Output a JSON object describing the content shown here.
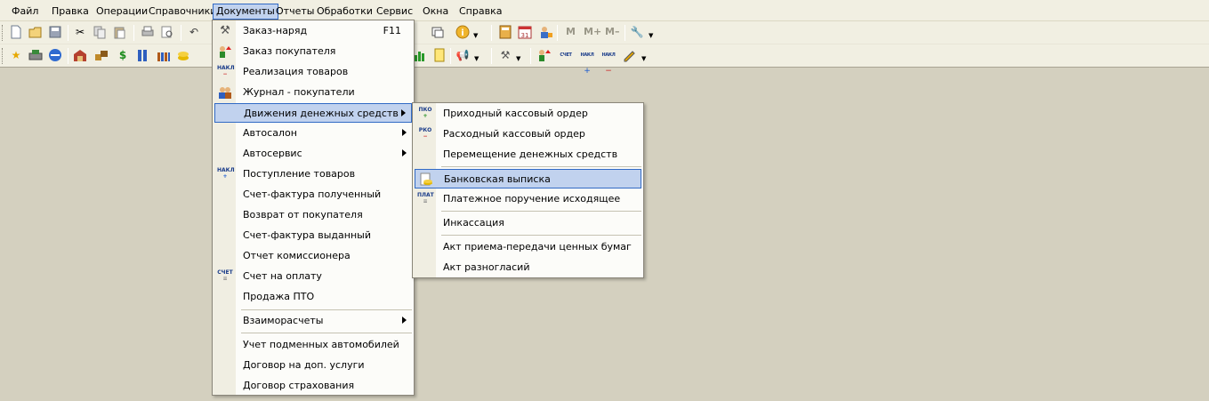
{
  "menubar": {
    "items": [
      {
        "label": "Файл",
        "key": "file"
      },
      {
        "label": "Правка",
        "key": "edit"
      },
      {
        "label": "Операции",
        "key": "operations"
      },
      {
        "label": "Справочники",
        "key": "references"
      },
      {
        "label": "Документы",
        "key": "documents"
      },
      {
        "label": "Отчеты",
        "key": "reports"
      },
      {
        "label": "Обработки",
        "key": "processing"
      },
      {
        "label": "Сервис",
        "key": "service"
      },
      {
        "label": "Окна",
        "key": "windows"
      },
      {
        "label": "Справка",
        "key": "help"
      }
    ]
  },
  "toolbar1": {
    "icons": [
      "new-icon",
      "open-icon",
      "save-icon",
      "cut-icon",
      "copy-icon",
      "paste-icon",
      "print-icon",
      "preview-icon",
      "undo-icon",
      "window-icon",
      "info-icon",
      "calculator-icon",
      "calendar-icon",
      "users-icon",
      "wrench-icon"
    ],
    "memory_buttons": [
      "M",
      "M+",
      "M–"
    ]
  },
  "toolbar2": {
    "icons": [
      "star-icon",
      "printer-icon",
      "exchange-icon",
      "warehouse-icon",
      "goods-icon",
      "dollar-icon",
      "people-icon",
      "group-icon",
      "coins-icon",
      "chart-icon",
      "horn-icon",
      "hammer-icon",
      "transfer-icon",
      "invoice-icon",
      "waybill-plus-icon",
      "waybill-minus-icon",
      "edit-doc-icon"
    ],
    "badges": {
      "invoice": "СЧЕТ",
      "waybill": "НАКЛ"
    }
  },
  "documents_menu": {
    "items": [
      {
        "label": "Заказ-наряд",
        "shortcut": "F11",
        "icon": "hammer-icon",
        "submenu": false
      },
      {
        "label": "Заказ покупателя",
        "icon": "order-icon",
        "submenu": false
      },
      {
        "label": "Реализация товаров",
        "icon": "waybill-minus-icon",
        "badge": "НАКЛ",
        "submenu": false
      },
      {
        "label": "Журнал - покупатели",
        "icon": "customers-icon",
        "submenu": false
      },
      {
        "label": "Движения денежных средств",
        "submenu": true,
        "highlighted": true
      },
      {
        "label": "Автосалон",
        "submenu": true
      },
      {
        "label": "Автосервис",
        "submenu": true
      },
      {
        "label": "Поступление товаров",
        "icon": "waybill-plus-icon",
        "badge": "НАКЛ",
        "submenu": false
      },
      {
        "label": "Счет-фактура полученный",
        "submenu": false
      },
      {
        "label": "Возврат от покупателя",
        "submenu": false
      },
      {
        "label": "Счет-фактура выданный",
        "submenu": false
      },
      {
        "label": "Отчет комиссионера",
        "submenu": false
      },
      {
        "label": "Счет на оплату",
        "icon": "invoice-icon",
        "badge": "СЧЕТ",
        "submenu": false
      },
      {
        "label": "Продажа ПТО",
        "submenu": false
      },
      {
        "label": "Взаиморасчеты",
        "submenu": true
      },
      {
        "label": "Учет подменных автомобилей",
        "submenu": false
      },
      {
        "label": "Договор на доп. услуги",
        "submenu": false
      },
      {
        "label": "Договор страхования",
        "submenu": false
      }
    ]
  },
  "cash_submenu": {
    "items": [
      {
        "label": "Приходный кассовый ордер",
        "icon": "cash-in-icon",
        "badge": "ПКО"
      },
      {
        "label": "Расходный кассовый ордер",
        "icon": "cash-out-icon",
        "badge": "РКО"
      },
      {
        "label": "Перемещение денежных средств"
      },
      {
        "label": "Банковская выписка",
        "icon": "bank-statement-icon",
        "highlighted": true
      },
      {
        "label": "Платежное поручение исходящее",
        "icon": "payment-order-icon",
        "badge": "ПЛАТ"
      },
      {
        "label": "Инкассация"
      },
      {
        "label": "Акт приема-передачи ценных бумаг"
      },
      {
        "label": "Акт разногласий"
      }
    ]
  },
  "colors": {
    "background": "#d4d0bf",
    "menubar": "#f1efe2",
    "highlight": "#c1d2ee",
    "highlight_border": "#316ac5"
  }
}
